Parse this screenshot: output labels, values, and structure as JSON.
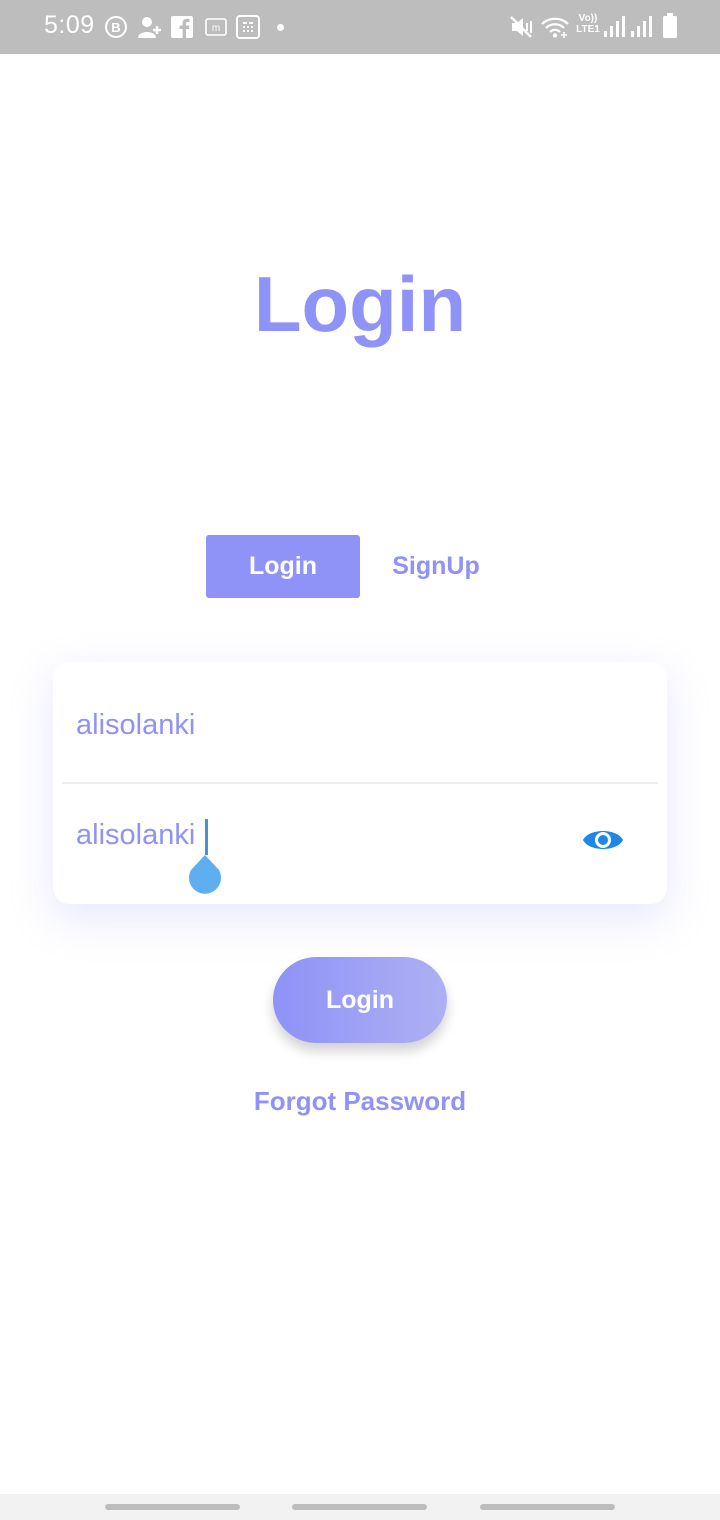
{
  "status_bar": {
    "time": "5:09",
    "left_icons": [
      "b-circle-icon",
      "add-person-icon",
      "facebook-icon",
      "m-box-icon",
      "calculator-icon",
      "dot-icon"
    ],
    "right_icons": [
      "mute-vibrate-icon",
      "wifi-icon",
      "volte-icon",
      "signal-icon",
      "signal-icon",
      "battery-icon"
    ],
    "lte_label": "Vo)) LTE1"
  },
  "page": {
    "title": "Login"
  },
  "tabs": [
    {
      "label": "Login",
      "active": true
    },
    {
      "label": "SignUp",
      "active": false
    }
  ],
  "form": {
    "username_value": "alisolanki",
    "password_value": "alisolanki",
    "visibility_icon": "eye-icon"
  },
  "actions": {
    "login_label": "Login",
    "forgot_label": "Forgot Password"
  },
  "colors": {
    "accent": "#8f92f7",
    "accent_light": "#aeb0f3",
    "status_bar": "#bdbdbd",
    "eye_icon": "#1e88e5",
    "cursor": "#4a90d9"
  }
}
